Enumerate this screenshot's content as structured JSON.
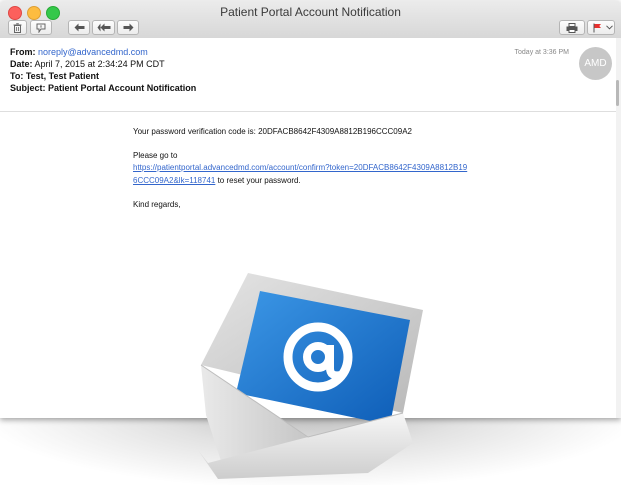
{
  "window": {
    "title": "Patient Portal Account Notification"
  },
  "header": {
    "from_label": "From:",
    "from_value": "noreply@advancedmd.com",
    "date_label": "Date:",
    "date_value": "April 7, 2015 at 2:34:24 PM CDT",
    "to_label": "To:",
    "to_value": "Test, Test Patient",
    "subject_label": "Subject:",
    "subject_value": "Patient Portal Account Notification",
    "timestamp": "Today at 3:36 PM",
    "avatar_initials": "AMD"
  },
  "message": {
    "code_line": "Your password verification code is: 20DFACB8642F4309A8812B196CCC09A2",
    "go_to": "Please go to",
    "link_part1": "https://patientportal.advancedmd.com/account/confirm?token=20DFACB8642F4309A8812B19",
    "link_part2": "6CCC09A2&lk=118741",
    "link_suffix": " to reset your password.",
    "closing": "Kind regards,"
  },
  "colors": {
    "link": "#3366cc",
    "flag": "#e8302f",
    "envelope_blue": "#1a78d2"
  },
  "icons": {
    "toolbar": [
      "trash-icon",
      "junk-icon",
      "reply-icon",
      "reply-all-icon",
      "forward-icon",
      "print-icon",
      "flag-icon"
    ],
    "illustration": "email-envelope-at-icon"
  }
}
